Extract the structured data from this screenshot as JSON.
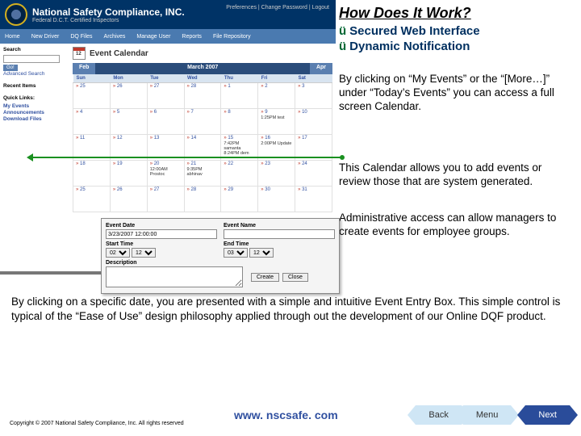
{
  "slide": {
    "title": "How Does It Work?",
    "bullets": {
      "b1": "Secured Web Interface",
      "b2": "Dynamic Notification"
    },
    "p1": "By clicking on “My Events” or the “[More…]” under “Today’s Events” you can access a full screen Calendar.",
    "p2": "This Calendar allows you to add events or review those that are system generated.",
    "p3": "Administrative access can allow managers to create events for employee groups.",
    "bottom": "By clicking on a specific date, you are presented with a simple and intuitive Event Entry Box. This simple control is typical of the “Ease of Use” design philosophy applied through out the development of our Online DQF product.",
    "copyright": "Copyright © 2007 National Safety Compliance, Inc. All rights reserved",
    "website": "www. nscsafe. com",
    "nav": {
      "back": "Back",
      "menu": "Menu",
      "next": "Next"
    }
  },
  "app": {
    "company": "National Safety Compliance, INC.",
    "tagline": "Federal D.C.T. Certified Inspectors",
    "topLinks": "Preferences | Change Password | Logout",
    "navbar": [
      "Home",
      "New Driver",
      "DQ Files",
      "Archives",
      "Manage User",
      "Reports",
      "File Repository"
    ],
    "sidebar": {
      "searchTitle": "Search",
      "goBtn": "Go!",
      "adv": "Advanced Search",
      "recentTitle": "Recent Items",
      "quickTitle": "Quick Links:",
      "quick": [
        "My Events",
        "Announcements",
        "Download Files"
      ]
    },
    "calendar": {
      "iconDay": "12",
      "title": "Event Calendar",
      "prevMonth": "Feb",
      "curMonth": "March 2007",
      "nextMonth": "Apr",
      "days": [
        "Sun",
        "Mon",
        "Tue",
        "Wed",
        "Thu",
        "Fri",
        "Sat"
      ],
      "weeks": [
        [
          {
            "n": "25"
          },
          {
            "n": "26"
          },
          {
            "n": "27"
          },
          {
            "n": "28"
          },
          {
            "n": "1"
          },
          {
            "n": "2"
          },
          {
            "n": "3"
          }
        ],
        [
          {
            "n": "4"
          },
          {
            "n": "5"
          },
          {
            "n": "6"
          },
          {
            "n": "7"
          },
          {
            "n": "8"
          },
          {
            "n": "9",
            "e": "1:25PM test"
          },
          {
            "n": "10"
          }
        ],
        [
          {
            "n": "11"
          },
          {
            "n": "12"
          },
          {
            "n": "13"
          },
          {
            "n": "14"
          },
          {
            "n": "15",
            "e": "7:42PM samanta\n8:24PM dem"
          },
          {
            "n": "16",
            "e": "2:00PM Update"
          },
          {
            "n": "17"
          }
        ],
        [
          {
            "n": "18"
          },
          {
            "n": "19"
          },
          {
            "n": "20",
            "e": "12:00AM Prostoc"
          },
          {
            "n": "21",
            "e": "9:35PM abhinav"
          },
          {
            "n": "22"
          },
          {
            "n": "23"
          },
          {
            "n": "24"
          }
        ],
        [
          {
            "n": "25"
          },
          {
            "n": "26"
          },
          {
            "n": "27"
          },
          {
            "n": "28"
          },
          {
            "n": "29"
          },
          {
            "n": "30"
          },
          {
            "n": "31"
          }
        ]
      ]
    },
    "eventForm": {
      "dateLbl": "Event Date",
      "dateVal": "3/23/2007 12:00:00",
      "nameLbl": "Event Name",
      "startLbl": "Start Time",
      "endLbl": "End Time",
      "descLbl": "Description",
      "hour1": "02",
      "hour2": "03",
      "ampm": "12",
      "createBtn": "Create",
      "closeBtn": "Close"
    }
  }
}
